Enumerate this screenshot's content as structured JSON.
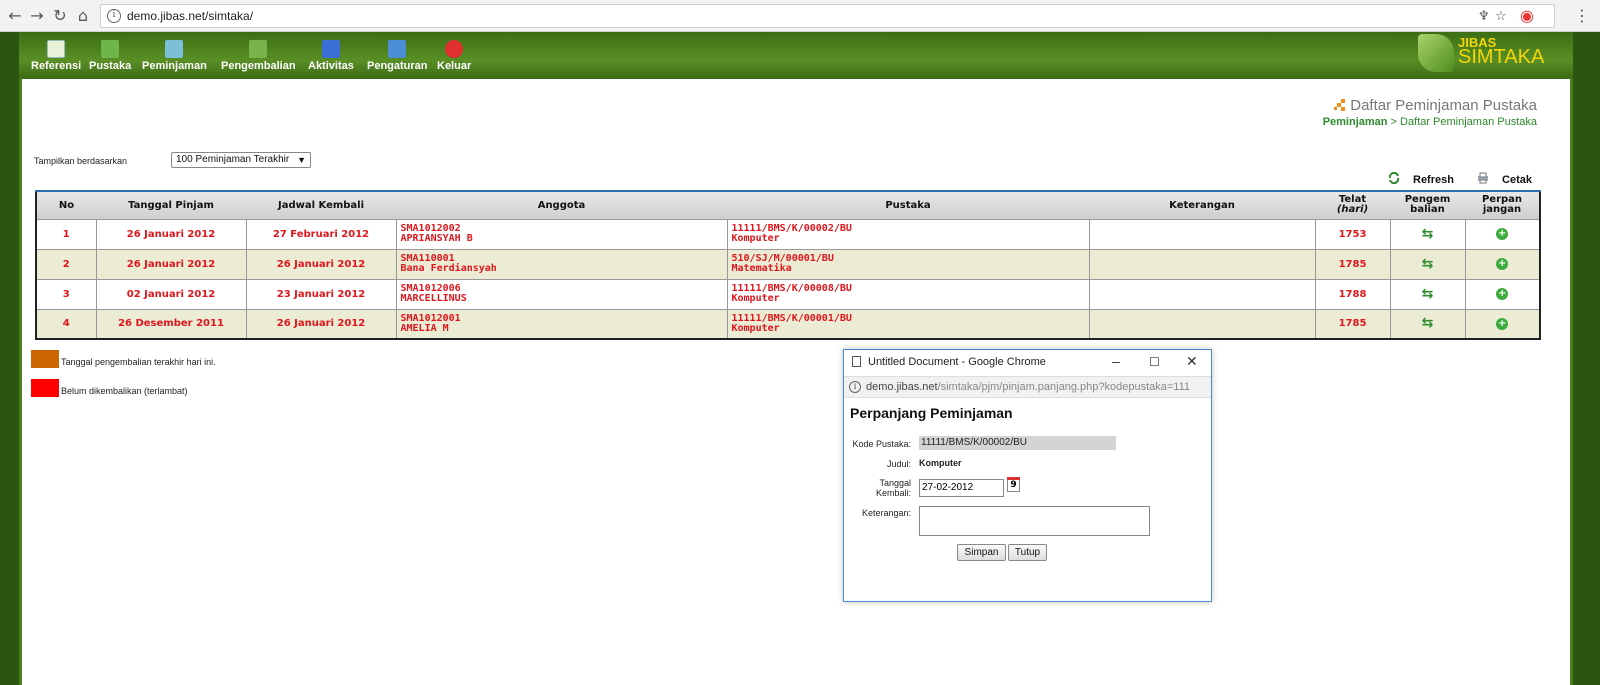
{
  "browser": {
    "url": "demo.jibas.net/simtaka/"
  },
  "menu": [
    {
      "label": "Referensi",
      "color": "#e9f2d9"
    },
    {
      "label": "Pustaka",
      "color": "#6fb64a"
    },
    {
      "label": "Peminjaman",
      "color": "#7cc0d8"
    },
    {
      "label": "Pengembalian",
      "color": "#7ab24a"
    },
    {
      "label": "Aktivitas",
      "color": "#3b6fd6"
    },
    {
      "label": "Pengaturan",
      "color": "#4b8ed6"
    },
    {
      "label": "Keluar",
      "color": "#e03030"
    }
  ],
  "logo": {
    "top": "JIBAS",
    "bottom": "SIMTAKA"
  },
  "page": {
    "title": "Daftar Peminjaman Pustaka",
    "breadcrumb_parent": "Peminjaman",
    "breadcrumb_sep": " > ",
    "breadcrumb_current": "Daftar Peminjaman Pustaka"
  },
  "filter": {
    "label": "Tampilkan berdasarkan",
    "selected": "100 Peminjaman Terakhir"
  },
  "actions": {
    "refresh": "Refresh",
    "print": "Cetak"
  },
  "table": {
    "headers": {
      "no": "No",
      "tanggal": "Tanggal Pinjam",
      "jadwal": "Jadwal Kembali",
      "anggota": "Anggota",
      "pustaka": "Pustaka",
      "keterangan": "Keterangan",
      "telat1": "Telat",
      "telat2": "(hari)",
      "pengem1": "Pengem",
      "pengem2": "balian",
      "perpan1": "Perpan",
      "perpan2": "jangan"
    },
    "rows": [
      {
        "no": "1",
        "tanggal": "26 Januari 2012",
        "jadwal": "27 Februari 2012",
        "anggota_id": "SMA1012002",
        "anggota_nama": "APRIANSYAH B",
        "kode": "11111/BMS/K/00002/BU",
        "judul": "Komputer",
        "keterangan": "",
        "telat": "1753"
      },
      {
        "no": "2",
        "tanggal": "26 Januari 2012",
        "jadwal": "26 Januari 2012",
        "anggota_id": "SMA110001",
        "anggota_nama": "Bana Ferdiansyah",
        "kode": "510/SJ/M/00001/BU",
        "judul": "Matematika",
        "keterangan": "",
        "telat": "1785"
      },
      {
        "no": "3",
        "tanggal": "02 Januari 2012",
        "jadwal": "23 Januari 2012",
        "anggota_id": "SMA1012006",
        "anggota_nama": "MARCELLINUS",
        "kode": "11111/BMS/K/00008/BU",
        "judul": "Komputer",
        "keterangan": "",
        "telat": "1788"
      },
      {
        "no": "4",
        "tanggal": "26 Desember 2011",
        "jadwal": "26 Januari 2012",
        "anggota_id": "SMA1012001",
        "anggota_nama": "AMELIA M",
        "kode": "11111/BMS/K/00001/BU",
        "judul": "Komputer",
        "keterangan": "",
        "telat": "1785"
      }
    ]
  },
  "legend": [
    {
      "color": "#cc6600",
      "text": "Tanggal pengembalian terakhir hari ini."
    },
    {
      "color": "#ff0000",
      "text": "Belum dikembalikan (terlambat)"
    }
  ],
  "popup": {
    "window_title": "Untitled Document - Google Chrome",
    "url_host": "demo.jibas.net",
    "url_path": "/simtaka/pjm/pinjam.panjang.php?kodepustaka=111",
    "heading": "Perpanjang Peminjaman",
    "kode_label": "Kode Pustaka:",
    "kode_value": "11111/BMS/K/00002/BU",
    "judul_label": "Judul:",
    "judul_value": "Komputer",
    "tanggal_label1": "Tanggal",
    "tanggal_label2": "Kembali:",
    "tanggal_value": "27-02-2012",
    "calendar_day": "9",
    "ket_label": "Keterangan:",
    "save": "Simpan",
    "close": "Tutup"
  }
}
